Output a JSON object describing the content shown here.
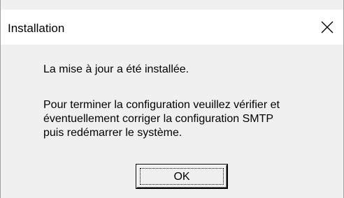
{
  "window": {
    "title": "Installation",
    "close_icon": "close-icon"
  },
  "message": {
    "line1": "La mise à jour a été installée.",
    "line2": "Pour terminer la configuration veuillez vérifier et",
    "line3": "éventuellement corriger la configuration SMTP",
    "line4": "puis redémarrer le système."
  },
  "buttons": {
    "ok_label": "OK"
  }
}
